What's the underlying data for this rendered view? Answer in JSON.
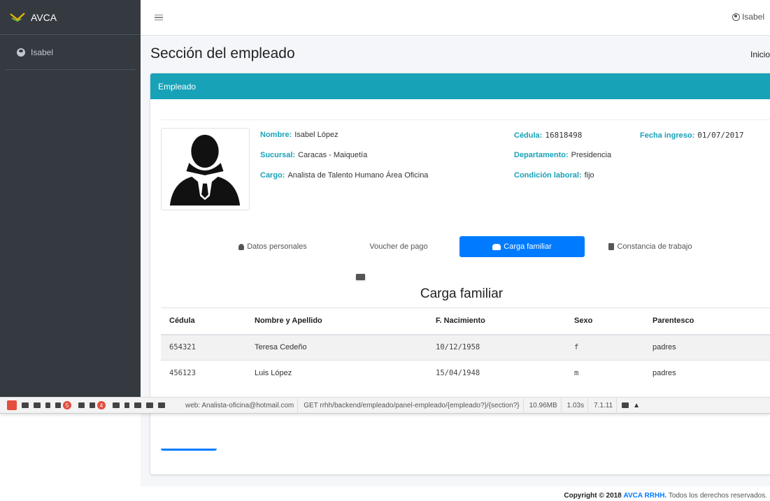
{
  "brand": {
    "name": "AVCA"
  },
  "sidebar": {
    "user_name": "Isabel"
  },
  "navbar": {
    "user_name": "Isabel"
  },
  "page": {
    "title": "Sección del empleado",
    "breadcrumb": "Inicio"
  },
  "card": {
    "header": "Empleado"
  },
  "employee": {
    "nombre": {
      "label": "Nombre:",
      "value": "Isabel López"
    },
    "sucursal": {
      "label": "Sucursal:",
      "value": "Caracas - Maiquetía"
    },
    "cargo": {
      "label": "Cargo:",
      "value": "Analista de Talento Humano Área Oficina"
    },
    "cedula": {
      "label": "Cédula:",
      "value": "16818498"
    },
    "departamento": {
      "label": "Departamento:",
      "value": "Presidencia"
    },
    "condicion": {
      "label": "Condición laboral:",
      "value": "fijo"
    },
    "fecha_ingreso": {
      "label": "Fecha ingreso:",
      "value": "01/07/2017"
    }
  },
  "tabs": [
    {
      "label": "Datos personales",
      "icon": "user-icon",
      "active": false
    },
    {
      "label": "Voucher de pago",
      "icon": "id-card-icon",
      "active": false
    },
    {
      "label": "Carga familiar",
      "icon": "users-icon",
      "active": true
    },
    {
      "label": "Constancia de trabajo",
      "icon": "file-icon",
      "active": false
    }
  ],
  "family": {
    "title": "Carga familiar",
    "columns": [
      "Cédula",
      "Nombre y Apellido",
      "F. Nacimiento",
      "Sexo",
      "Parentesco"
    ],
    "rows": [
      [
        "654321",
        "Teresa Cedeño",
        "10/12/1958",
        "f",
        "padres"
      ],
      [
        "456123",
        "Luis López",
        "15/04/1948",
        "m",
        "padres"
      ]
    ]
  },
  "debugbar": {
    "badge_messages": "5",
    "badge_queries": "4",
    "user_info": "web: Analista-oficina@hotmail.com",
    "route": "GET rrhh/backend/empleado/panel-empleado/{empleado?}/{section?}",
    "memory": "10.96MB",
    "time": "1.03s",
    "php_version": "7.1.11"
  },
  "footer": {
    "prefix": "Copyright © 2018",
    "link": "AVCA RRHH.",
    "suffix": "Todos los derechos reservados."
  },
  "colors": {
    "sidebar": "#343a40",
    "info": "#17a2b8",
    "primary": "#007bff"
  }
}
